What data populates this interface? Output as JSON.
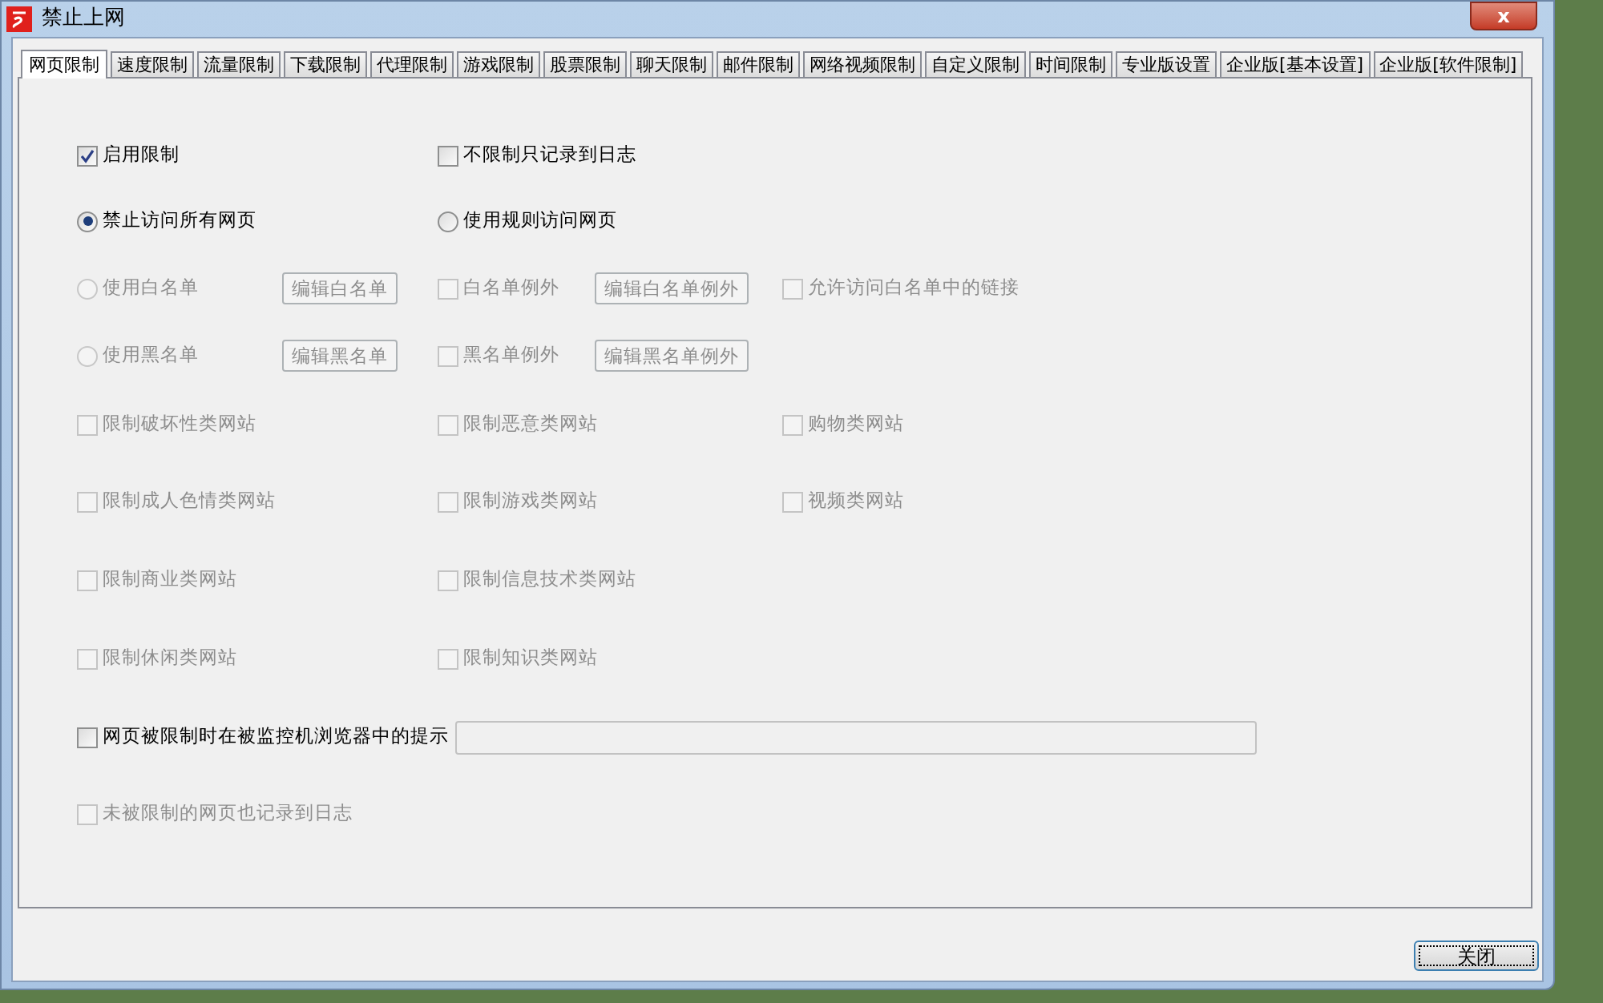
{
  "window": {
    "title": "禁止上网",
    "close_glyph": "x"
  },
  "tabs": [
    {
      "label": "网页限制",
      "selected": true
    },
    {
      "label": "速度限制",
      "selected": false
    },
    {
      "label": "流量限制",
      "selected": false
    },
    {
      "label": "下载限制",
      "selected": false
    },
    {
      "label": "代理限制",
      "selected": false
    },
    {
      "label": "游戏限制",
      "selected": false
    },
    {
      "label": "股票限制",
      "selected": false
    },
    {
      "label": "聊天限制",
      "selected": false
    },
    {
      "label": "邮件限制",
      "selected": false
    },
    {
      "label": "网络视频限制",
      "selected": false
    },
    {
      "label": "自定义限制",
      "selected": false
    },
    {
      "label": "时间限制",
      "selected": false
    },
    {
      "label": "专业版设置",
      "selected": false
    },
    {
      "label": "企业版[基本设置]",
      "selected": false
    },
    {
      "label": "企业版[软件限制]",
      "selected": false
    }
  ],
  "rows": [
    {
      "columns": [
        [
          {
            "kind": "checkbox",
            "label": "启用限制",
            "checked": true,
            "disabled": false
          }
        ],
        [
          {
            "kind": "checkbox",
            "label": "不限制只记录到日志",
            "checked": false,
            "disabled": false
          }
        ],
        []
      ]
    },
    {
      "columns": [
        [
          {
            "kind": "radio",
            "label": "禁止访问所有网页",
            "selected": true,
            "disabled": false
          }
        ],
        [
          {
            "kind": "radio",
            "label": "使用规则访问网页",
            "selected": false,
            "disabled": false
          }
        ],
        []
      ]
    },
    {
      "columns": [
        [
          {
            "kind": "radio",
            "label": "使用白名单",
            "selected": false,
            "disabled": true
          },
          {
            "kind": "button",
            "label": "编辑白名单",
            "disabled": true
          }
        ],
        [
          {
            "kind": "checkbox",
            "label": "白名单例外",
            "checked": false,
            "disabled": true
          },
          {
            "kind": "button",
            "label": "编辑白名单例外",
            "disabled": true
          }
        ],
        [
          {
            "kind": "checkbox",
            "label": "允许访问白名单中的链接",
            "checked": false,
            "disabled": true
          }
        ]
      ]
    },
    {
      "columns": [
        [
          {
            "kind": "radio",
            "label": "使用黑名单",
            "selected": false,
            "disabled": true
          },
          {
            "kind": "button",
            "label": "编辑黑名单",
            "disabled": true
          }
        ],
        [
          {
            "kind": "checkbox",
            "label": "黑名单例外",
            "checked": false,
            "disabled": true
          },
          {
            "kind": "button",
            "label": "编辑黑名单例外",
            "disabled": true
          }
        ],
        []
      ]
    },
    {
      "columns": [
        [
          {
            "kind": "checkbox",
            "label": "限制破坏性类网站",
            "checked": false,
            "disabled": true
          }
        ],
        [
          {
            "kind": "checkbox",
            "label": "限制恶意类网站",
            "checked": false,
            "disabled": true
          }
        ],
        [
          {
            "kind": "checkbox",
            "label": "购物类网站",
            "checked": false,
            "disabled": true
          }
        ]
      ]
    },
    {
      "columns": [
        [
          {
            "kind": "checkbox",
            "label": "限制成人色情类网站",
            "checked": false,
            "disabled": true
          }
        ],
        [
          {
            "kind": "checkbox",
            "label": "限制游戏类网站",
            "checked": false,
            "disabled": true
          }
        ],
        [
          {
            "kind": "checkbox",
            "label": "视频类网站",
            "checked": false,
            "disabled": true
          }
        ]
      ]
    },
    {
      "columns": [
        [
          {
            "kind": "checkbox",
            "label": "限制商业类网站",
            "checked": false,
            "disabled": true
          }
        ],
        [
          {
            "kind": "checkbox",
            "label": "限制信息技术类网站",
            "checked": false,
            "disabled": true
          }
        ],
        []
      ]
    },
    {
      "columns": [
        [
          {
            "kind": "checkbox",
            "label": "限制休闲类网站",
            "checked": false,
            "disabled": true
          }
        ],
        [
          {
            "kind": "checkbox",
            "label": "限制知识类网站",
            "checked": false,
            "disabled": true
          }
        ],
        []
      ]
    },
    {
      "columns": [
        [
          {
            "kind": "checkbox",
            "label": "网页被限制时在被监控机浏览器中的提示",
            "checked": false,
            "disabled": false
          }
        ],
        [
          {
            "kind": "field",
            "disabled": true
          }
        ],
        []
      ]
    },
    {
      "columns": [
        [
          {
            "kind": "checkbox",
            "label": "未被限制的网页也记录到日志",
            "checked": false,
            "disabled": true
          }
        ],
        [],
        []
      ]
    }
  ],
  "close_button": {
    "label": "关闭"
  }
}
